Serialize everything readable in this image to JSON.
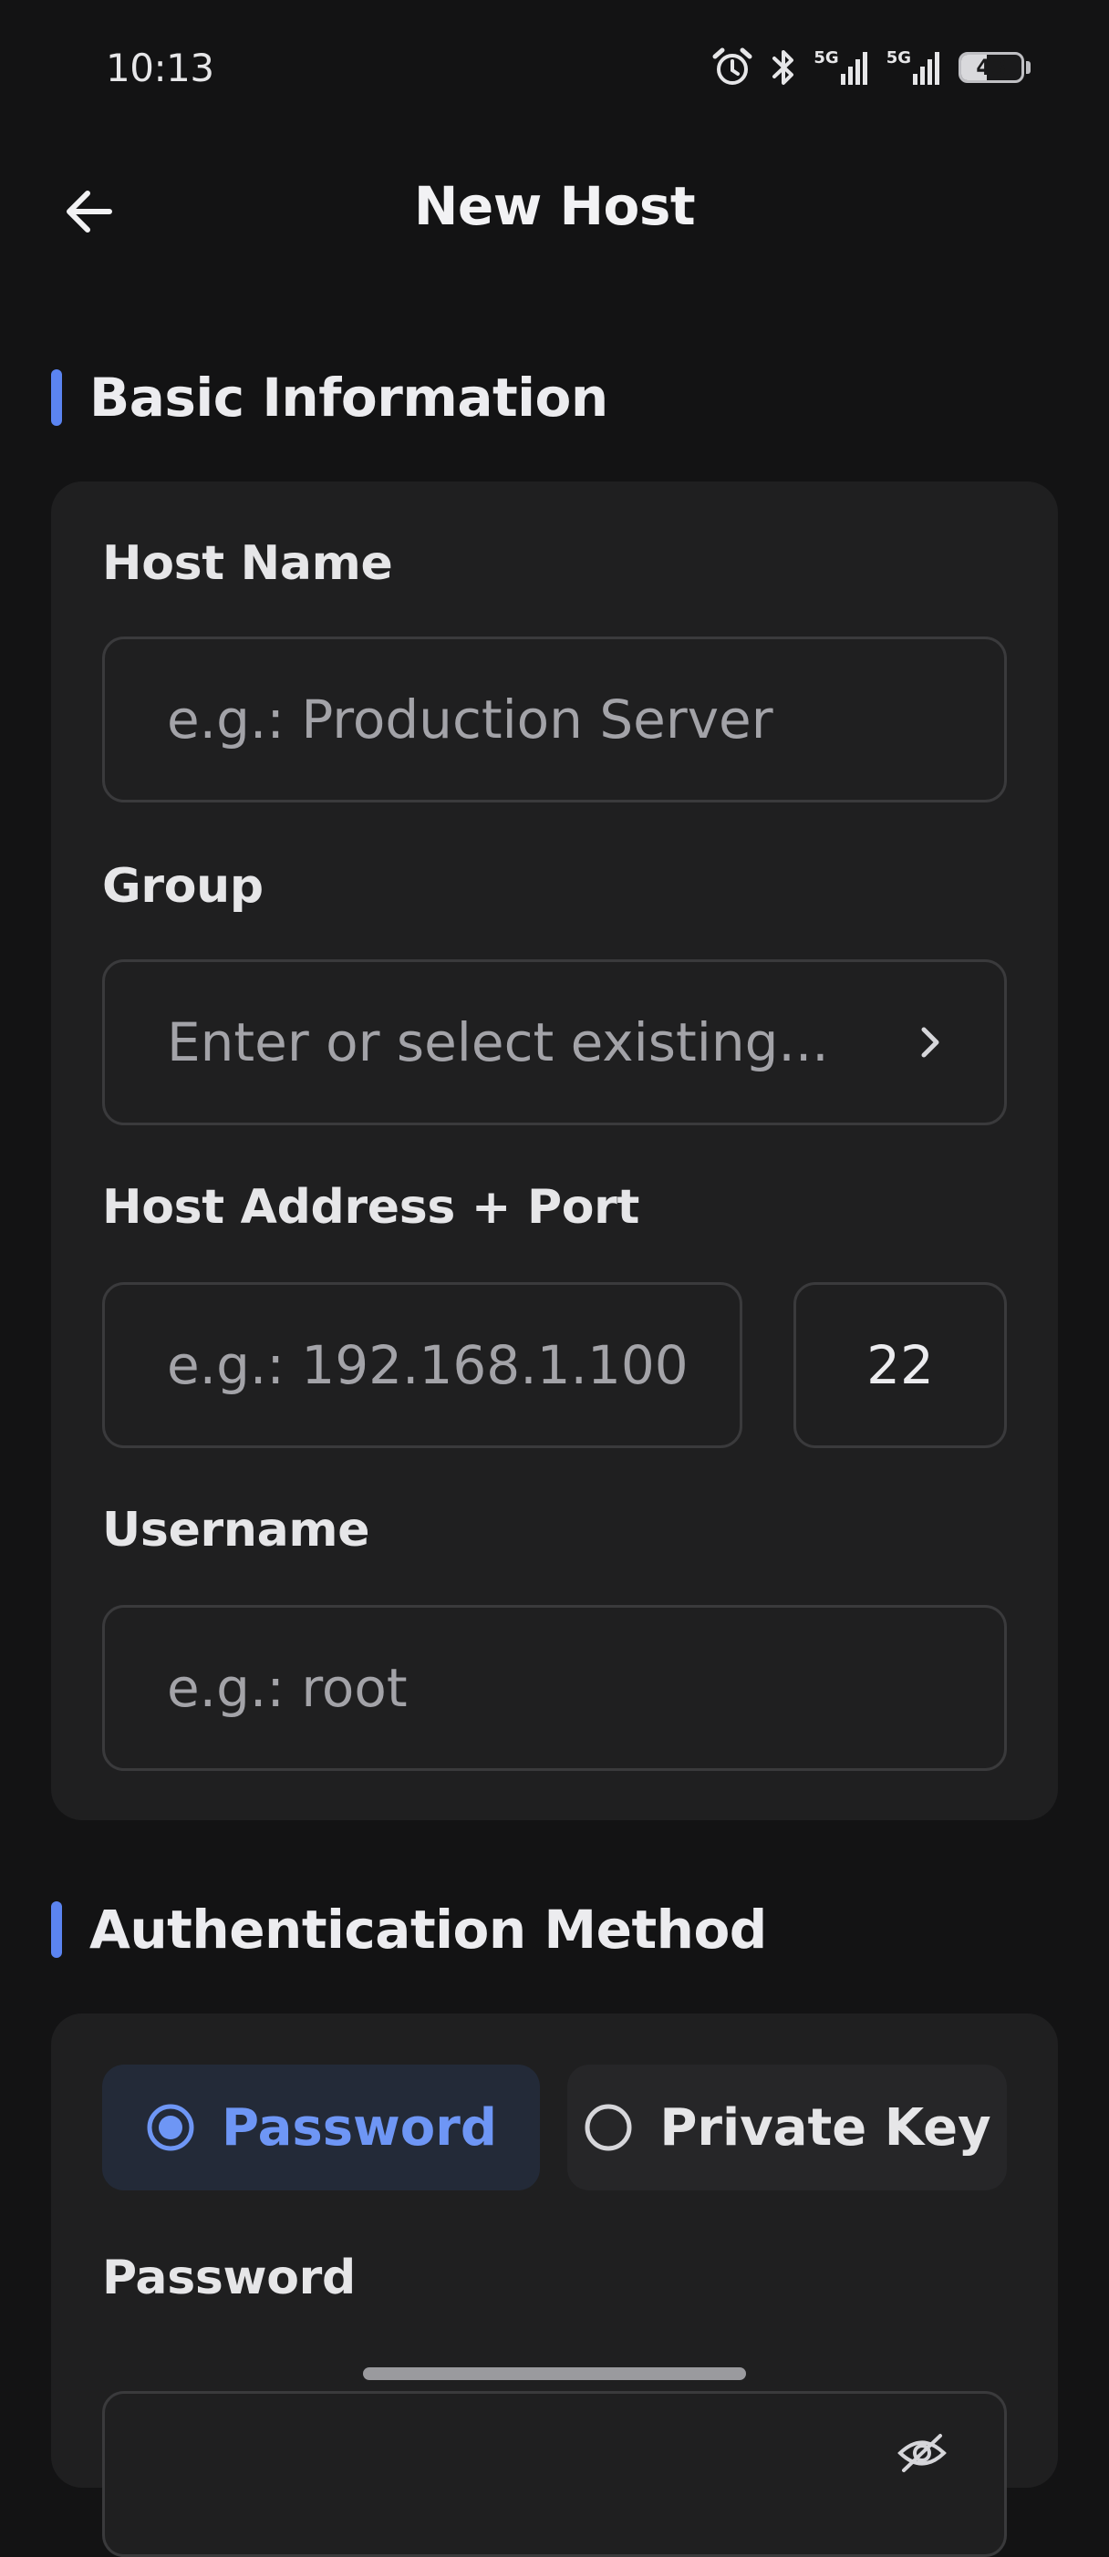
{
  "status_bar": {
    "time": "10:13",
    "network1": "5G",
    "network2": "5G",
    "battery_level": 43,
    "battery_text": "43",
    "icons": [
      "alarm-icon",
      "bluetooth-icon",
      "signal-5g-icon",
      "signal-5g-icon",
      "battery-icon"
    ]
  },
  "header": {
    "title": "New Host",
    "back_icon": "arrow-left-icon"
  },
  "basic_info": {
    "section_title": "Basic Information",
    "host_name": {
      "label": "Host Name",
      "placeholder": "e.g.: Production Server",
      "value": ""
    },
    "group": {
      "label": "Group",
      "placeholder": "Enter or select existing...",
      "value": "",
      "icon": "chevron-right-icon"
    },
    "address": {
      "label": "Host Address + Port",
      "placeholder": "e.g.: 192.168.1.100",
      "value": "",
      "port_value": "22"
    },
    "username": {
      "label": "Username",
      "placeholder": "e.g.: root",
      "value": ""
    }
  },
  "auth": {
    "section_title": "Authentication Method",
    "options": [
      {
        "label": "Password",
        "selected": true
      },
      {
        "label": "Private Key",
        "selected": false
      }
    ],
    "password": {
      "label": "Password",
      "placeholder": "",
      "value": "",
      "icon": "eye-off-icon"
    }
  },
  "colors": {
    "background": "#131314",
    "card": "#1f1f20",
    "accent": "#5b84f1",
    "selected_text": "#6e96f5"
  }
}
